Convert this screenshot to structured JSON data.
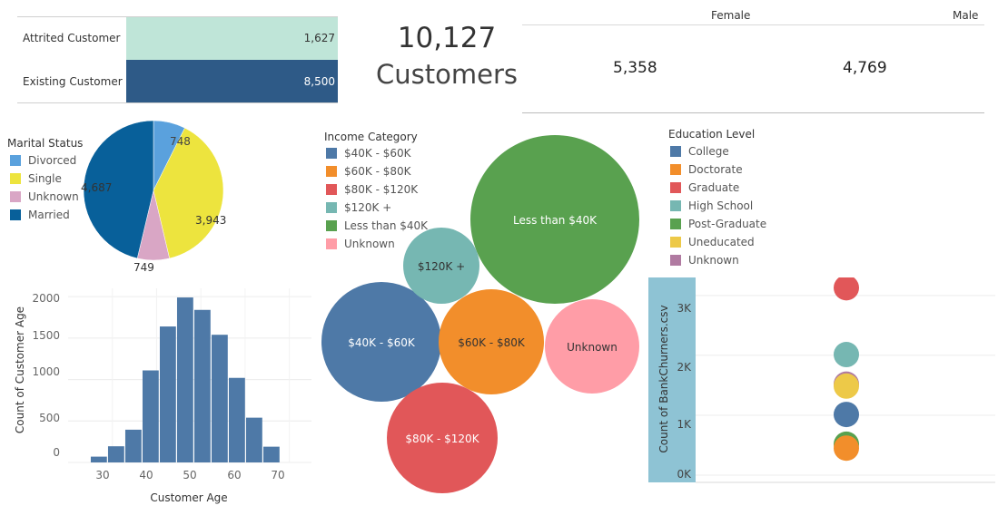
{
  "status_bars": {
    "rows": [
      {
        "label": "Attrited Customer",
        "value": 1627,
        "value_label": "1,627",
        "color": "#bfe5d8"
      },
      {
        "label": "Existing Customer",
        "value": 8500,
        "value_label": "8,500",
        "color": "#2e5a87"
      }
    ]
  },
  "kpi": {
    "number": "10,127",
    "label": "Customers"
  },
  "gender": {
    "female_label": "Female",
    "male_label": "Male",
    "female_value": "5,358",
    "male_value": "4,769"
  },
  "marital": {
    "title": "Marital Status",
    "items": [
      {
        "name": "Divorced",
        "color": "#5aa1dd",
        "value": 748
      },
      {
        "name": "Single",
        "color": "#ede43e",
        "value": 3943
      },
      {
        "name": "Unknown",
        "color": "#d9a6c5",
        "value": 749
      },
      {
        "name": "Married",
        "color": "#08609a",
        "value": 4687
      }
    ],
    "labels": {
      "divorced": "748",
      "single": "3,943",
      "unknown": "749",
      "married": "4,687"
    }
  },
  "income": {
    "title": "Income Category",
    "items": [
      {
        "name": "$40K - $60K",
        "color": "#4e79a7"
      },
      {
        "name": "$60K - $80K",
        "color": "#f28e2b"
      },
      {
        "name": "$80K - $120K",
        "color": "#e15759"
      },
      {
        "name": "$120K +",
        "color": "#76b7b2"
      },
      {
        "name": "Less than $40K",
        "color": "#59a14f"
      },
      {
        "name": "Unknown",
        "color": "#ff9da7"
      }
    ]
  },
  "education": {
    "title": "Education Level",
    "items": [
      {
        "name": "College",
        "color": "#4e79a7"
      },
      {
        "name": "Doctorate",
        "color": "#f28e2b"
      },
      {
        "name": "Graduate",
        "color": "#e15759"
      },
      {
        "name": "High School",
        "color": "#76b7b2"
      },
      {
        "name": "Post-Graduate",
        "color": "#59a14f"
      },
      {
        "name": "Uneducated",
        "color": "#edc948"
      },
      {
        "name": "Unknown",
        "color": "#b07aa1"
      }
    ]
  },
  "chart_data": [
    {
      "type": "bar",
      "orientation": "horizontal",
      "categories": [
        "Attrited Customer",
        "Existing Customer"
      ],
      "values": [
        1627,
        8500
      ]
    },
    {
      "type": "pie",
      "title": "Marital Status",
      "categories": [
        "Divorced",
        "Single",
        "Unknown",
        "Married"
      ],
      "values": [
        748,
        3943,
        749,
        4687
      ]
    },
    {
      "type": "bubble",
      "title": "Income Category",
      "categories": [
        "Less than $40K",
        "$40K - $60K",
        "$80K - $120K",
        "$60K - $80K",
        "Unknown",
        "$120K +"
      ],
      "values": [
        3561,
        1790,
        1535,
        1402,
        1112,
        727
      ]
    },
    {
      "type": "bar",
      "xlabel": "Customer Age",
      "ylabel": "Count of Customer Age",
      "xlim": [
        20,
        75
      ],
      "ylim": [
        0,
        2100
      ],
      "x_ticks": [
        "30",
        "40",
        "50",
        "60",
        "70"
      ],
      "y_ticks": [
        "0",
        "500",
        "1000",
        "1500",
        "2000"
      ],
      "bin_start": 25,
      "bin_width": 3.9,
      "values": [
        70,
        195,
        395,
        1110,
        1640,
        1990,
        1840,
        1540,
        1020,
        540,
        190
      ]
    },
    {
      "type": "scatter",
      "ylabel": "Count of BankChurners.csv",
      "y_ticks": [
        "0K",
        "1K",
        "2K",
        "3K"
      ],
      "ylim": [
        0,
        3300
      ],
      "series": [
        {
          "name": "Graduate",
          "value": 3128,
          "color": "#e15759"
        },
        {
          "name": "High School",
          "value": 2013,
          "color": "#76b7b2"
        },
        {
          "name": "Unknown",
          "value": 1519,
          "color": "#b07aa1"
        },
        {
          "name": "Uneducated",
          "value": 1487,
          "color": "#edc948"
        },
        {
          "name": "College",
          "value": 1013,
          "color": "#4e79a7"
        },
        {
          "name": "Post-Graduate",
          "value": 516,
          "color": "#59a14f"
        },
        {
          "name": "Doctorate",
          "value": 451,
          "color": "#f28e2b"
        }
      ]
    }
  ]
}
